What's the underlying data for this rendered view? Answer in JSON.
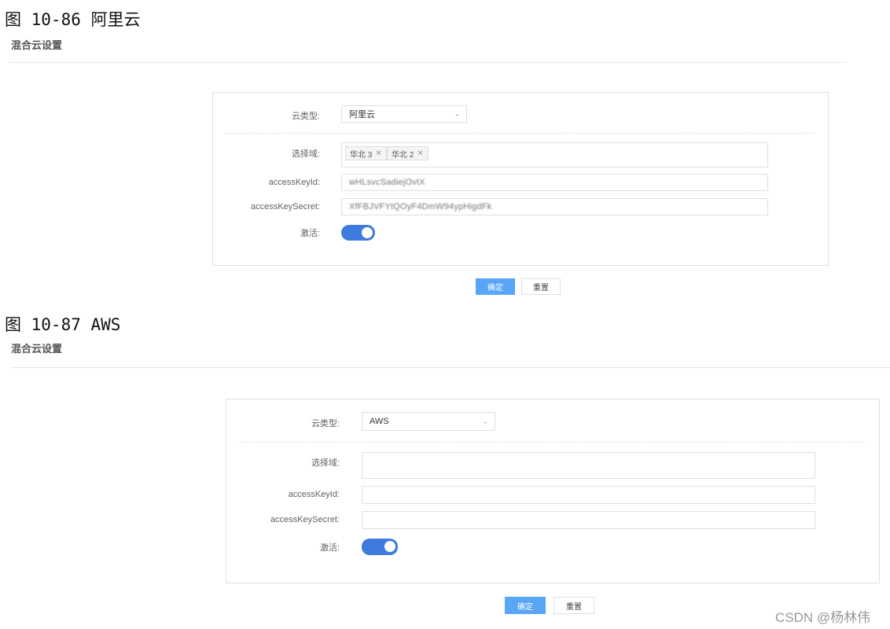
{
  "figures": [
    {
      "caption": "图 10-86 阿里云",
      "section_title": "混合云设置",
      "form": {
        "cloud_type_label": "云类型:",
        "cloud_type_value": "阿里云",
        "region_label": "选择域:",
        "region_tags": [
          "华北 3",
          "华北 2"
        ],
        "access_key_id_label": "accessKeyId:",
        "access_key_id_value": "wHLsvcSadiejOvtX",
        "access_key_secret_label": "accessKeySecret:",
        "access_key_secret_value": "XfFBJVFYtQOyF4DmW94ypHigdFk",
        "activate_label": "激活:",
        "activate_on": true
      },
      "buttons": {
        "confirm": "确定",
        "reset": "重置"
      }
    },
    {
      "caption": "图 10-87 AWS",
      "section_title": "混合云设置",
      "form": {
        "cloud_type_label": "云类型:",
        "cloud_type_value": "AWS",
        "region_label": "选择域:",
        "region_tags": [],
        "access_key_id_label": "accessKeyId:",
        "access_key_id_value": "",
        "access_key_secret_label": "accessKeySecret:",
        "access_key_secret_value": "",
        "activate_label": "激活:",
        "activate_on": true
      },
      "buttons": {
        "confirm": "确定",
        "reset": "重置"
      }
    }
  ],
  "watermark": "CSDN @杨林伟",
  "icons": {
    "dropdown": "chevron-down-icon",
    "tag_close": "close-icon"
  },
  "colors": {
    "switch_on": "#3f7bdc",
    "primary_button": "#5aa6f6"
  }
}
